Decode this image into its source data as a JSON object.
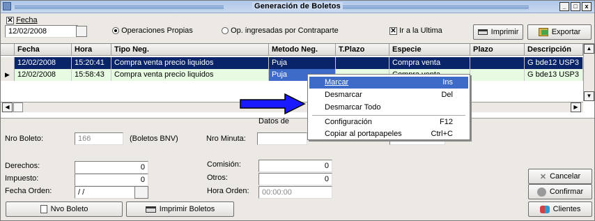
{
  "window": {
    "title": "Generación de Boletos",
    "controls": [
      "_",
      "□",
      "x"
    ]
  },
  "topbar": {
    "fecha_label": "Fecha",
    "fecha_checked": true,
    "fecha_value": "12/02/2008",
    "radio_propias": "Operaciones Propias",
    "radio_contraparte": "Op. ingresadas por Contraparte",
    "ir_ultima_label": "Ir a la Ultima",
    "ir_ultima_checked": true,
    "print_button": "Imprimir",
    "export_button": "Exportar"
  },
  "grid": {
    "columns": [
      "Fecha",
      "Hora",
      "Tipo Neg.",
      "Metodo Neg.",
      "T.Plazo",
      "Especie",
      "Plazo",
      "Descripción"
    ],
    "rows": [
      [
        "12/02/2008",
        "15:20:41",
        "Compra venta precio liquidos",
        "Puja",
        "",
        "Compra venta",
        "",
        "G bde12 USP3"
      ],
      [
        "12/02/2008",
        "15:58:43",
        "Compra venta precio liquidos",
        "Puja",
        "",
        "Compra venta",
        "",
        "G bde13 USP3"
      ]
    ]
  },
  "form": {
    "section_title": "Datos de",
    "nro_boleto_label": "Nro Boleto:",
    "nro_boleto_value": "166",
    "boletos_bnv": "(Boletos BNV)",
    "nro_minuta_label": "Nro Minuta:",
    "derechos_label": "Derechos:",
    "derechos_value": "0",
    "impuesto_label": "Impuesto:",
    "impuesto_value": "0",
    "fecha_orden_label": "Fecha Orden:",
    "fecha_orden_value": " / /",
    "comision_label": "Comisión:",
    "comision_value": "0",
    "otros_label": "Otros:",
    "otros_value": "0",
    "hora_orden_label": "Hora Orden:",
    "hora_orden_value": "00:00:00",
    "cancel_button": "Cancelar",
    "confirm_button": "Confirmar"
  },
  "bottombar": {
    "nvo_boleto": "Nvo Boleto",
    "imprimir_boletos": "Imprimir Boletos",
    "clientes": "Clientes"
  },
  "context_menu": {
    "items": [
      {
        "label": "Marcar",
        "key": "Ins"
      },
      {
        "label": "Desmarcar",
        "key": "Del"
      },
      {
        "label": "Desmarcar Todo",
        "key": ""
      },
      {
        "label": "Configuración",
        "key": "F12"
      },
      {
        "label": "Copiar al portapapeles",
        "key": "Ctrl+C"
      }
    ]
  },
  "colors": {
    "selection": "#0a246a",
    "menu_highlight": "#3d6bc7",
    "row_alt": "#e6fbe2",
    "arrow": "#1a1aff"
  }
}
